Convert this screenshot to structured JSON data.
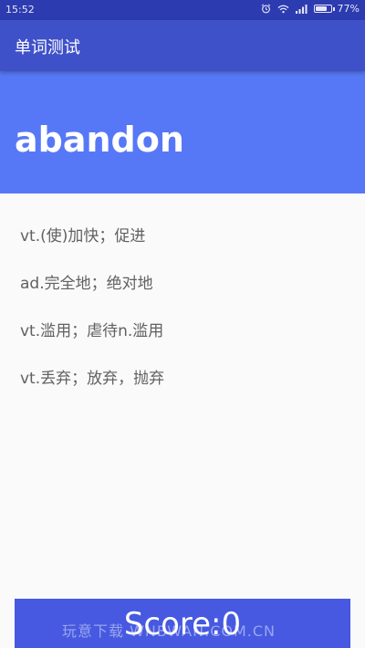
{
  "status_bar": {
    "time": "15:52",
    "battery_percent": "77%",
    "battery_level": 0.77,
    "icons": [
      "alarm-icon",
      "wifi-icon",
      "signal-icon",
      "battery-icon"
    ]
  },
  "app_bar": {
    "title": "单词测试"
  },
  "word": {
    "text": "abandon"
  },
  "options": [
    "vt.(使)加快；促进",
    "ad.完全地；绝对地",
    "vt.滥用；虐待n.滥用",
    "vt.丢弃；放弃，抛弃"
  ],
  "score": {
    "label": "Score:0"
  },
  "watermark": "玩意下载 WNBWAN.COM.CN",
  "colors": {
    "status_bar": "#2d3bb0",
    "app_bar": "#3f51c9",
    "word_banner": "#5778f6",
    "score_button": "#4659e0",
    "option_text": "#616161"
  }
}
